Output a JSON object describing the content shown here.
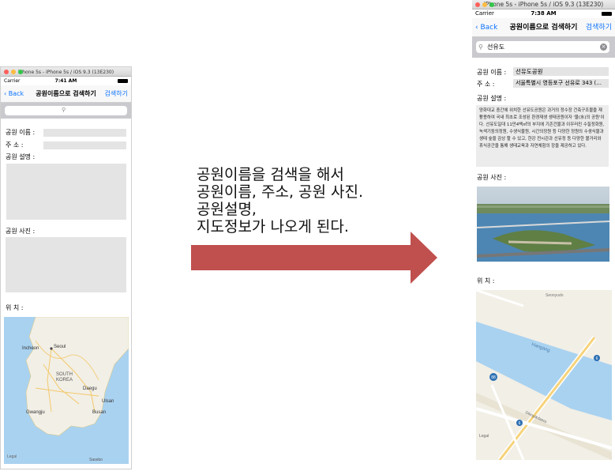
{
  "caption": {
    "lines": [
      "공원이름을 검색을 해서",
      "공원이름, 주소, 공원 사진.",
      "공원설명,",
      "지도정보가 나오게 된다."
    ]
  },
  "left_sim": {
    "window_title": "iPhone 5s - iPhone 5s / iOS 9.3 (13E230)",
    "carrier": "Carrier",
    "time": "7:41 AM",
    "back_label": "Back",
    "title": "공원이름으로 검색하기",
    "action_label": "검색하기",
    "search_value": "",
    "labels": {
      "name": "공원 이름 :",
      "address": "주    소 :",
      "description": "공원 설명 :",
      "photo": "공원 사진 :",
      "location": "위    치 :"
    },
    "map_labels": {
      "incheon": "Incheon",
      "seoul": "Seoul",
      "south_korea": "SOUTH\nKOREA",
      "daegu": "Daegu",
      "gwangju": "Gwangju",
      "busan": "Busan",
      "ulsan": "Ulsan",
      "legal": "Legal",
      "sasebo": "Sasebo"
    }
  },
  "right_sim": {
    "window_title": "iPhone 5s - iPhone 5s / iOS 9.3 (13E230)",
    "carrier": "Carrier",
    "time": "7:38 AM",
    "back_label": "Back",
    "title": "공원이름으로 검색하기",
    "action_label": "검색하기",
    "search_value": "선유도",
    "labels": {
      "name": "공원 이름 :",
      "address": "주    소 :",
      "description": "공원 설명 :",
      "photo": "공원 사진 :",
      "location": "위    치 :"
    },
    "values": {
      "name": "선유도공원",
      "address": "서울특별시 영등포구 선유로 343 (...",
      "description": "양화대교 중간에 위치한 선유도공원은 과거의 정수장 건축구조물을 재활용하여 국내 최초로 조성된 환경재생 생태공원이자 '물(水)의 공원'이다. 선유도일대 11만4백㎡의 부지에 기존건물과 이우러진 수질정화원, 녹색기둥의정원, 수생식물원, 시간의정원 등 다양한 정원의 수생식물과 생태 숲을 감상 할 수 있고, 한강 전시관과 선유정 등 다양한 볼거리와 휴식공간을 통해 생태교육과 자연체험의 장을 제공하고 있다."
    },
    "map_labels": {
      "seonyudo": "Seonyudo",
      "hangang": "Hangang",
      "road_badge": "88",
      "route_badge": "6",
      "olympic": "Olimpikdaero",
      "legal": "Legal"
    }
  },
  "colors": {
    "arrow": "#c0504d",
    "ios_blue": "#0a72ff",
    "map_water": "#a9d2f0",
    "map_land": "#f2efe6"
  }
}
